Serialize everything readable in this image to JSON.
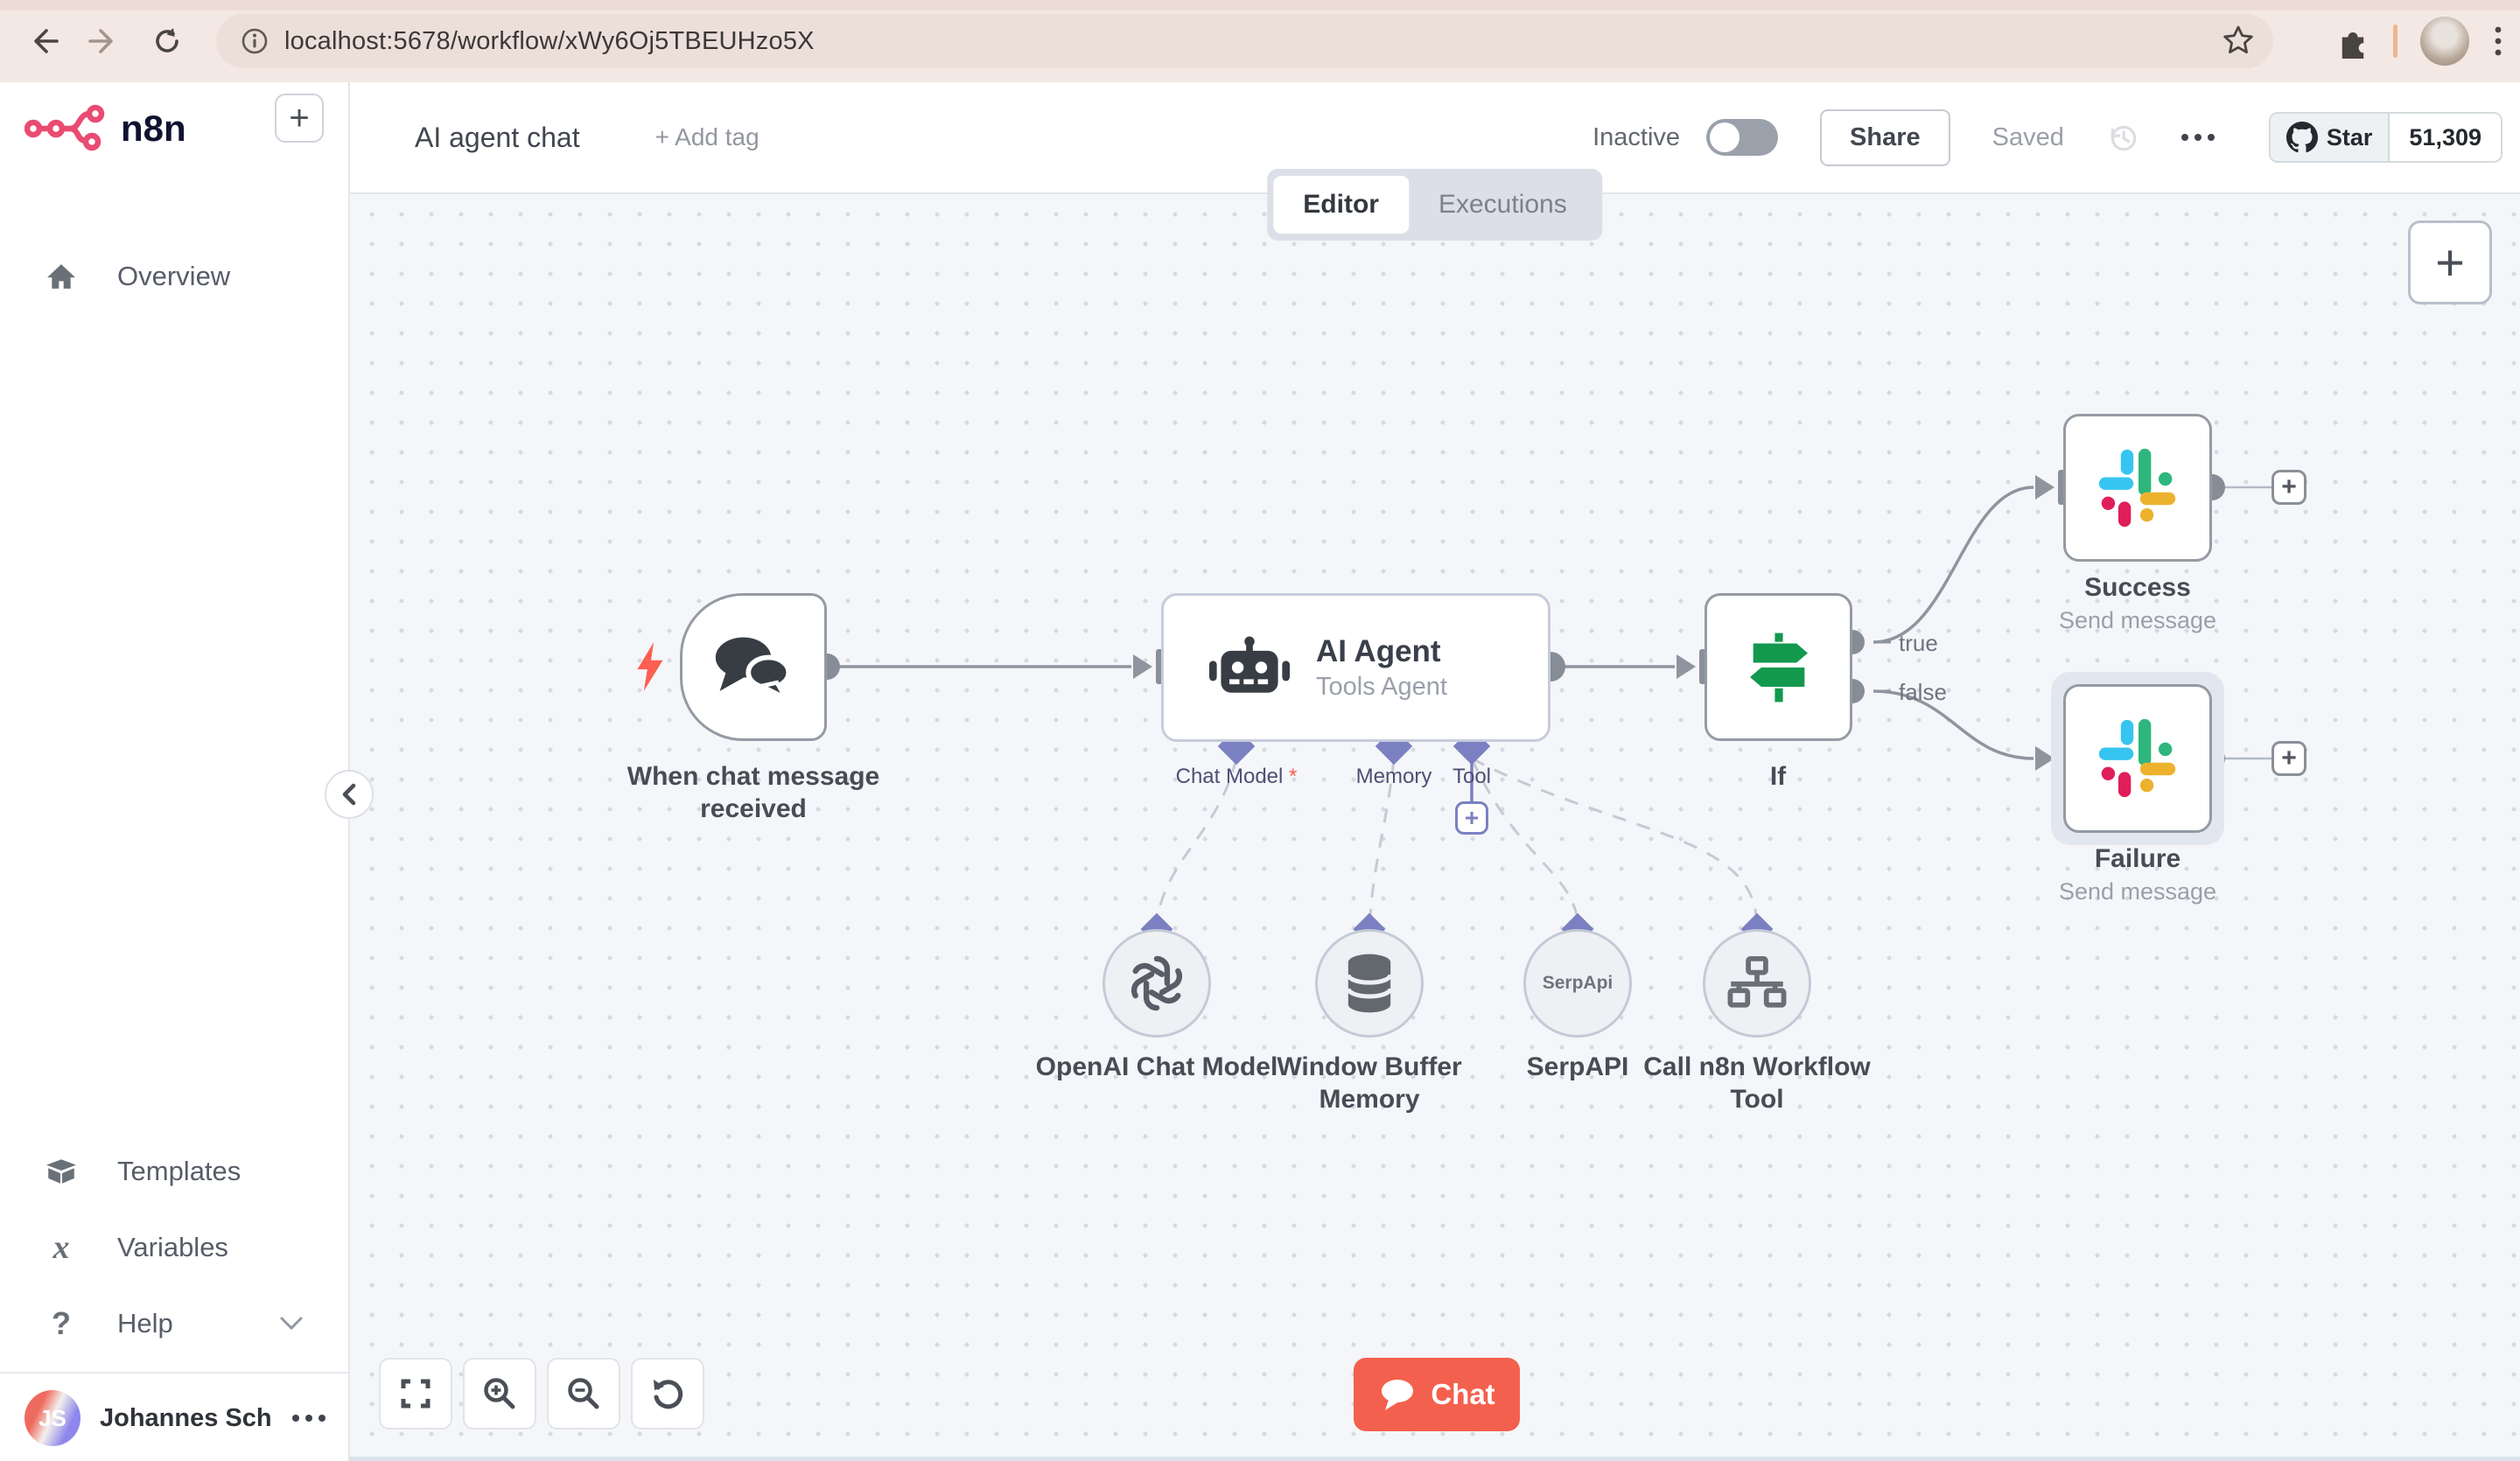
{
  "browser": {
    "url": "localhost:5678/workflow/xWy6Oj5TBEUHzo5X"
  },
  "sidebar": {
    "logo_text": "n8n",
    "items": [
      {
        "label": "Overview"
      }
    ],
    "bottom_items": [
      {
        "label": "Templates"
      },
      {
        "label": "Variables"
      },
      {
        "label": "Help"
      }
    ],
    "user": {
      "initials": "JS",
      "name": "Johannes Schn..."
    }
  },
  "header": {
    "title": "AI agent chat",
    "add_tag": "+ Add tag",
    "status_label": "Inactive",
    "share_label": "Share",
    "saved_label": "Saved",
    "github": {
      "star_label": "Star",
      "count": "51,309"
    }
  },
  "tabs": {
    "editor": "Editor",
    "executions": "Executions"
  },
  "canvas": {
    "trigger": {
      "label": "When chat message received"
    },
    "agent": {
      "title": "AI Agent",
      "subtitle": "Tools Agent",
      "ports": {
        "chat_model": "Chat Model",
        "required_mark": "*",
        "memory": "Memory",
        "tool": "Tool"
      }
    },
    "subnodes": [
      {
        "label": "OpenAI Chat Model"
      },
      {
        "label": "Window Buffer Memory"
      },
      {
        "label": "SerpAPI",
        "icon_text": "SerpApi"
      },
      {
        "label": "Call n8n Workflow Tool"
      }
    ],
    "if": {
      "label": "If",
      "outputs": [
        "true",
        "false"
      ]
    },
    "success": {
      "label": "Success",
      "subtitle": "Send message"
    },
    "failure": {
      "label": "Failure",
      "subtitle": "Send message"
    },
    "chat_button": "Chat"
  },
  "icons": {
    "trigger": "chat-bubbles-icon",
    "agent": "robot-icon",
    "if": "signpost-icon",
    "slack": "slack-icon",
    "openai": "openai-icon",
    "memory": "database-icon",
    "workflow_tool": "sitemap-icon"
  },
  "colors": {
    "n8n_pink": "#EA4B71",
    "chat_coral": "#F4604E",
    "port_indigo": "#7B80C2",
    "if_green": "#12994E",
    "slack": [
      "#36C5F0",
      "#2EB67D",
      "#ECB22E",
      "#E01E5A"
    ],
    "github_dark": "#24292F"
  }
}
